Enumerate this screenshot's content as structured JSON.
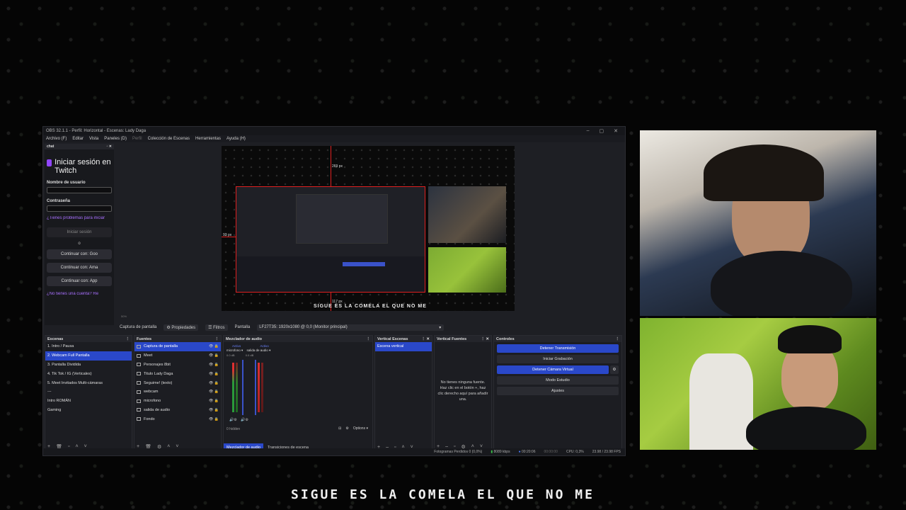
{
  "window": {
    "title": "OBS 32.1.1 - Perfil: Horizontal - Escenas: Lady Daga",
    "controls": [
      "–",
      "▢",
      "✕"
    ]
  },
  "menu": [
    "Archivo (F)",
    "Editar",
    "Vista",
    "Paneles (D)",
    "Perfil",
    "Colección de Escenas",
    "Herramientas",
    "Ayuda (H)"
  ],
  "chat": {
    "dock_title": "chat",
    "login_title": "Iniciar sesión en Twitch",
    "username_label": "Nombre de usuario",
    "password_label": "Contraseña",
    "trouble_link": "¿Tienes problemas para iniciar",
    "login_button": "Iniciar sesión",
    "or": "o",
    "google_button": "Continuar con: Goo",
    "amazon_button": "Continuar con: Ama",
    "apple_button": "Continuar con: App",
    "signup_link": "¿No tienes una cuenta? Re"
  },
  "preview": {
    "top_dim": "269 px",
    "left_dim": "93 px",
    "bottom_dim": "117 px",
    "caption": "SIGUE ES LA COMELA EL QUE NO ME"
  },
  "zoom": "50%",
  "source_toolbar": {
    "source_name": "Captura de pantalla",
    "properties": "Propiedades",
    "filters": "Filtros",
    "screen_label": "Pantalla",
    "screen_value": "LF27T35: 1920x1080 @ 0,0 (Monitor principal)"
  },
  "scenes": {
    "title": "Escenas",
    "items": [
      "1. Intro / Pausa",
      "2. Webcam Full Pantalla",
      "3. Pantalla Dividida",
      "4. Tik Tok / IG (Verticales)",
      "5. Meet Invitados Multi-cámaras",
      "---",
      "Intro ROMÁN",
      "Gaming"
    ],
    "active_index": 1
  },
  "sources": {
    "title": "Fuentes",
    "items": [
      "Captura de pantalla",
      "Meet",
      "Personajes 8bit",
      "Titulo Lady Daga",
      "Seguime! (texto)",
      "webcam",
      "microfono",
      "salida de audio",
      "Fondo"
    ],
    "active_index": 0
  },
  "mixer": {
    "title": "Mezclador de audio",
    "channels": [
      {
        "name": "microfono",
        "state": "Activo",
        "db": "0.0 dB"
      },
      {
        "name": "salida de audio",
        "state": "Activo",
        "db": "0.0 dB"
      }
    ],
    "hidden": "0 hidden",
    "options": "Options",
    "tab_mixer": "Mezclador de audio",
    "tab_transitions": "Transiciones de escena"
  },
  "vertical_scenes": {
    "title": "Vertical Escenas",
    "items": [
      "Escena vertical"
    ]
  },
  "vertical_sources": {
    "title": "Vertical Fuentes",
    "empty_text": "No tienes ninguna fuente. Haz clic en el botón +, haz clic derecho aquí para añadir una."
  },
  "controls": {
    "title": "Controles",
    "stop_stream": "Detener Transmisión",
    "start_record": "Iniciar Grabación",
    "stop_virtual_cam": "Detener Cámara Virtual",
    "studio_mode": "Modo Estudio",
    "settings": "Ajustes"
  },
  "status": {
    "dropped_frames": "Fotogramas Perdidos 0 (0,0%)",
    "bitrate": "8089 kbps",
    "stream_time": "00:20:06",
    "rec_time": "00:00:00",
    "cpu": "CPU: 0,3%",
    "fps": "23.98 / 23.98 FPS"
  },
  "caption": "SIGUE ES LA COMELA EL QUE NO ME"
}
